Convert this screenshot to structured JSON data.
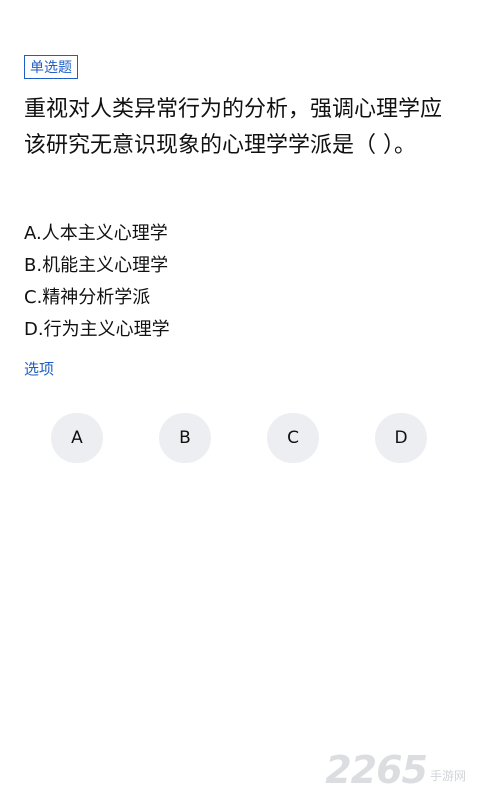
{
  "question": {
    "type_label": "单选题",
    "text": "重视对人类异常行为的分析，强调心理学应该研究无意识现象的心理学学派是（ ）。"
  },
  "options": [
    {
      "text": "A.人本主义心理学"
    },
    {
      "text": "B.机能主义心理学"
    },
    {
      "text": "C.精神分析学派"
    },
    {
      "text": "D.行为主义心理学"
    }
  ],
  "section_label": "选项",
  "choices": [
    {
      "label": "A"
    },
    {
      "label": "B"
    },
    {
      "label": "C"
    },
    {
      "label": "D"
    }
  ],
  "watermark": {
    "number": "2265",
    "text": "手游网"
  },
  "colors": {
    "accent": "#1f5fc4",
    "choice_bg": "#eceef2"
  }
}
